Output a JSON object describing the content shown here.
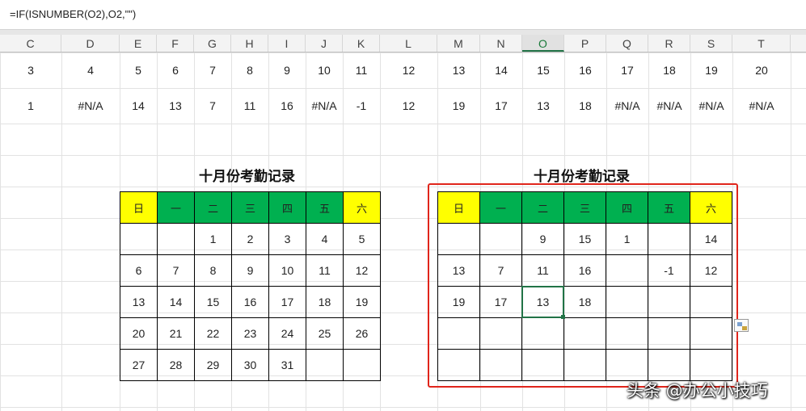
{
  "formula_bar": {
    "formula": "=IF(ISNUMBER(O2),O2,\"\")"
  },
  "column_headers": [
    "C",
    "D",
    "E",
    "F",
    "G",
    "H",
    "I",
    "J",
    "K",
    "L",
    "M",
    "N",
    "O",
    "P",
    "Q",
    "R",
    "S",
    "T"
  ],
  "active_column": "O",
  "row1": [
    "3",
    "4",
    "5",
    "6",
    "7",
    "8",
    "9",
    "10",
    "11",
    "12",
    "13",
    "14",
    "15",
    "16",
    "17",
    "18",
    "19",
    "20"
  ],
  "row2": [
    "1",
    "#N/A",
    "14",
    "13",
    "7",
    "11",
    "16",
    "#N/A",
    "-1",
    "12",
    "19",
    "17",
    "13",
    "18",
    "#N/A",
    "#N/A",
    "#N/A",
    "#N/A"
  ],
  "calendar_left": {
    "title": "十月份考勤记录",
    "weekdays": [
      "日",
      "一",
      "二",
      "三",
      "四",
      "五",
      "六"
    ],
    "rows": [
      [
        "",
        "",
        "1",
        "2",
        "3",
        "4",
        "5"
      ],
      [
        "6",
        "7",
        "8",
        "9",
        "10",
        "11",
        "12"
      ],
      [
        "13",
        "14",
        "15",
        "16",
        "17",
        "18",
        "19"
      ],
      [
        "20",
        "21",
        "22",
        "23",
        "24",
        "25",
        "26"
      ],
      [
        "27",
        "28",
        "29",
        "30",
        "31",
        "",
        ""
      ]
    ]
  },
  "calendar_right": {
    "title": "十月份考勤记录",
    "weekdays": [
      "日",
      "一",
      "二",
      "三",
      "四",
      "五",
      "六"
    ],
    "rows": [
      [
        "",
        "",
        "9",
        "15",
        "1",
        "",
        "14"
      ],
      [
        "13",
        "7",
        "11",
        "16",
        "",
        "-1",
        "12"
      ],
      [
        "19",
        "17",
        "13",
        "18",
        "",
        "",
        ""
      ],
      [
        "",
        "",
        "",
        "",
        "",
        "",
        ""
      ],
      [
        "",
        "",
        "",
        "",
        "",
        "",
        ""
      ]
    ]
  },
  "colors": {
    "weekend_header": "#ffff00",
    "weekday_header": "#00b050",
    "highlight_border": "#e0251b",
    "selection": "#217346"
  },
  "watermark": "头条 @办公小技巧"
}
